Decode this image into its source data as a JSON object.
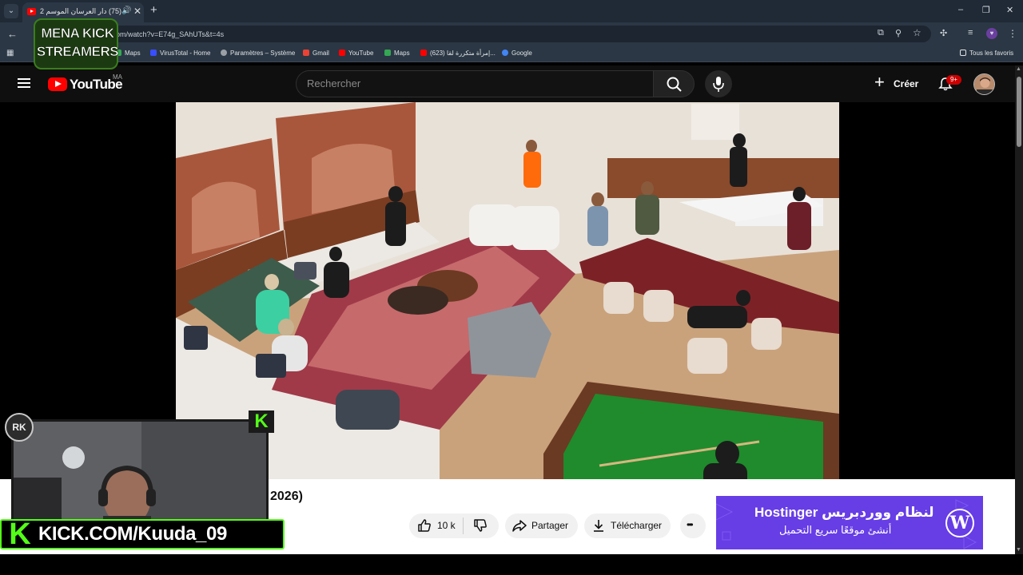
{
  "browser": {
    "tab": {
      "title": "(75) دار العرسان الموسم 2 |",
      "audio_icon": "speaker-icon"
    },
    "url": "om/watch?v=E74g_SAhUTs&t=4s",
    "bookmarks": [
      "Maps",
      "VirusTotal - Home",
      "Paramètres – Système",
      "Gmail",
      "YouTube",
      "Maps",
      "(623) إمرأة متكررة لقا...",
      "Google"
    ],
    "all_bookmarks": "Tous les favoris",
    "window_controls": [
      "–",
      "❐",
      "✕"
    ]
  },
  "youtube": {
    "logo_text": "YouTube",
    "country": "MA",
    "search_placeholder": "Rechercher",
    "create_label": "Créer",
    "notification_count": "9+",
    "video_title_visible": "2026)",
    "actions": {
      "like_count": "10 k",
      "share": "Partager",
      "download": "Télécharger",
      "more": "•••"
    },
    "ad": {
      "line1": "Hostinger لنظام ووردبريس",
      "line2": "أنشئ موقعًا سريع التحميل",
      "logo_letter": "W"
    }
  },
  "overlays": {
    "logo_line1": "MENA KICK",
    "logo_line2": "STREAMERS",
    "kick_k": "K",
    "badge": "RK",
    "kick_banner_k": "K",
    "kick_banner": "KICK.COM/Kuuda_09"
  },
  "colors": {
    "chrome_bg": "#2b3744",
    "youtube_bg": "#0f0f0f",
    "youtube_red": "#ff0000",
    "kick_green": "#53fc18",
    "hostinger_purple": "#673de6"
  }
}
